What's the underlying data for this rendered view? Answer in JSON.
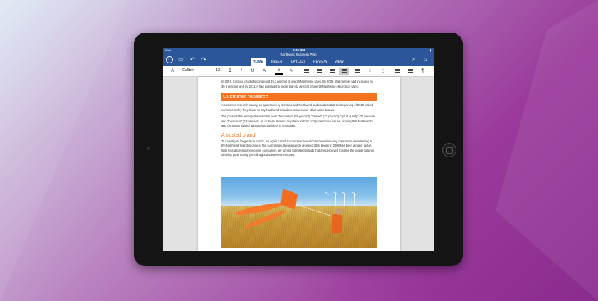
{
  "status": {
    "carrier": "iPad",
    "time": "2:46 PM",
    "battery": ""
  },
  "document": {
    "title": "Northwind Business Plan"
  },
  "ribbon": {
    "tabs": [
      {
        "label": "HOME",
        "active": true
      },
      {
        "label": "INSERT",
        "active": false
      },
      {
        "label": "LAYOUT",
        "active": false
      },
      {
        "label": "REVIEW",
        "active": false
      },
      {
        "label": "VIEW",
        "active": false
      }
    ]
  },
  "toolbar": {
    "font_name": "Calibri",
    "font_size": "12"
  },
  "content": {
    "intro": "In 2007, Contoso products comprised 35.2 percent of overall Northwind sales. By 2009, that number had increased to 39.8 percent, and by 2011, it had increased to more than 42 percent of overall Northwind electronics sales.",
    "heading1": "Customer research",
    "para1": "A customer research survey, co-sponsored by Contoso and Northwind and conducted at the beginning of 2013, asked consumers why they chose to buy Northwind brand electronics over other name brands.",
    "para2": "The phrases that emerged most often were \"best value\" (26 percent), \"trusted\" (23 percent), \"good quality\" (21 percent), and \"innovative\" (19 percent). All of these phrases map back to both companies' core values, proving that Northwind's and Contoso's shared approach to business is resonating.",
    "heading2": "A trusted brand",
    "para3": "To investigate longer-term trends, we again turned to customer research to determine why consumers were turning to the Northwind brand in droves. Not surprisingly, the worldwide recession that began in 2008 has been a major factor. With less discretionary income, consumers are turning to trusted brands that are perceived to strike the proper balance of being good quality yet still a good value for the money."
  },
  "colors": {
    "ribbon": "#2b579a",
    "accent": "#f37321"
  }
}
